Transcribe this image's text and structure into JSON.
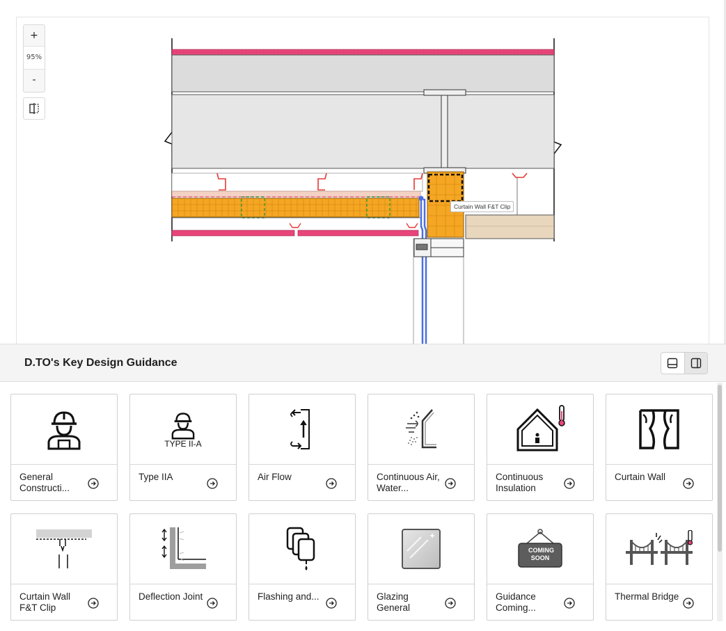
{
  "viewer": {
    "zoom_in_label": "+",
    "zoom_level": "95%",
    "zoom_out_label": "-",
    "tooltip": "Curtain Wall F&T Clip"
  },
  "panel": {
    "title": "D.TO's Key Design Guidance",
    "cards": [
      {
        "label": "General Constructi...",
        "icon": "worker-icon"
      },
      {
        "label": "Type IIA",
        "icon": "worker-type-iia-icon",
        "icon_text": "TYPE II-A"
      },
      {
        "label": "Air Flow",
        "icon": "air-flow-icon"
      },
      {
        "label": "Continuous Air, Water...",
        "icon": "continuous-barrier-icon"
      },
      {
        "label": "Continuous Insulation",
        "icon": "house-thermometer-icon"
      },
      {
        "label": "Curtain Wall",
        "icon": "curtain-icon"
      },
      {
        "label": "Curtain Wall F&T Clip",
        "icon": "clip-icon"
      },
      {
        "label": "Deflection Joint",
        "icon": "deflection-joint-icon"
      },
      {
        "label": "Flashing and...",
        "icon": "flashing-icon"
      },
      {
        "label": "Glazing General",
        "icon": "glazing-icon"
      },
      {
        "label": "Guidance Coming...",
        "icon": "coming-soon-sign-icon",
        "icon_text": "COMING SOON"
      },
      {
        "label": "Thermal Bridge",
        "icon": "bridge-thermometer-icon"
      }
    ]
  },
  "colors": {
    "insulation": "#f5a623",
    "membrane": "#e8457a",
    "slab": "#dcdcdc",
    "accent_blue": "#4a6fe0",
    "clip_red": "#e53935",
    "dashed_green": "#2e9d3a"
  }
}
